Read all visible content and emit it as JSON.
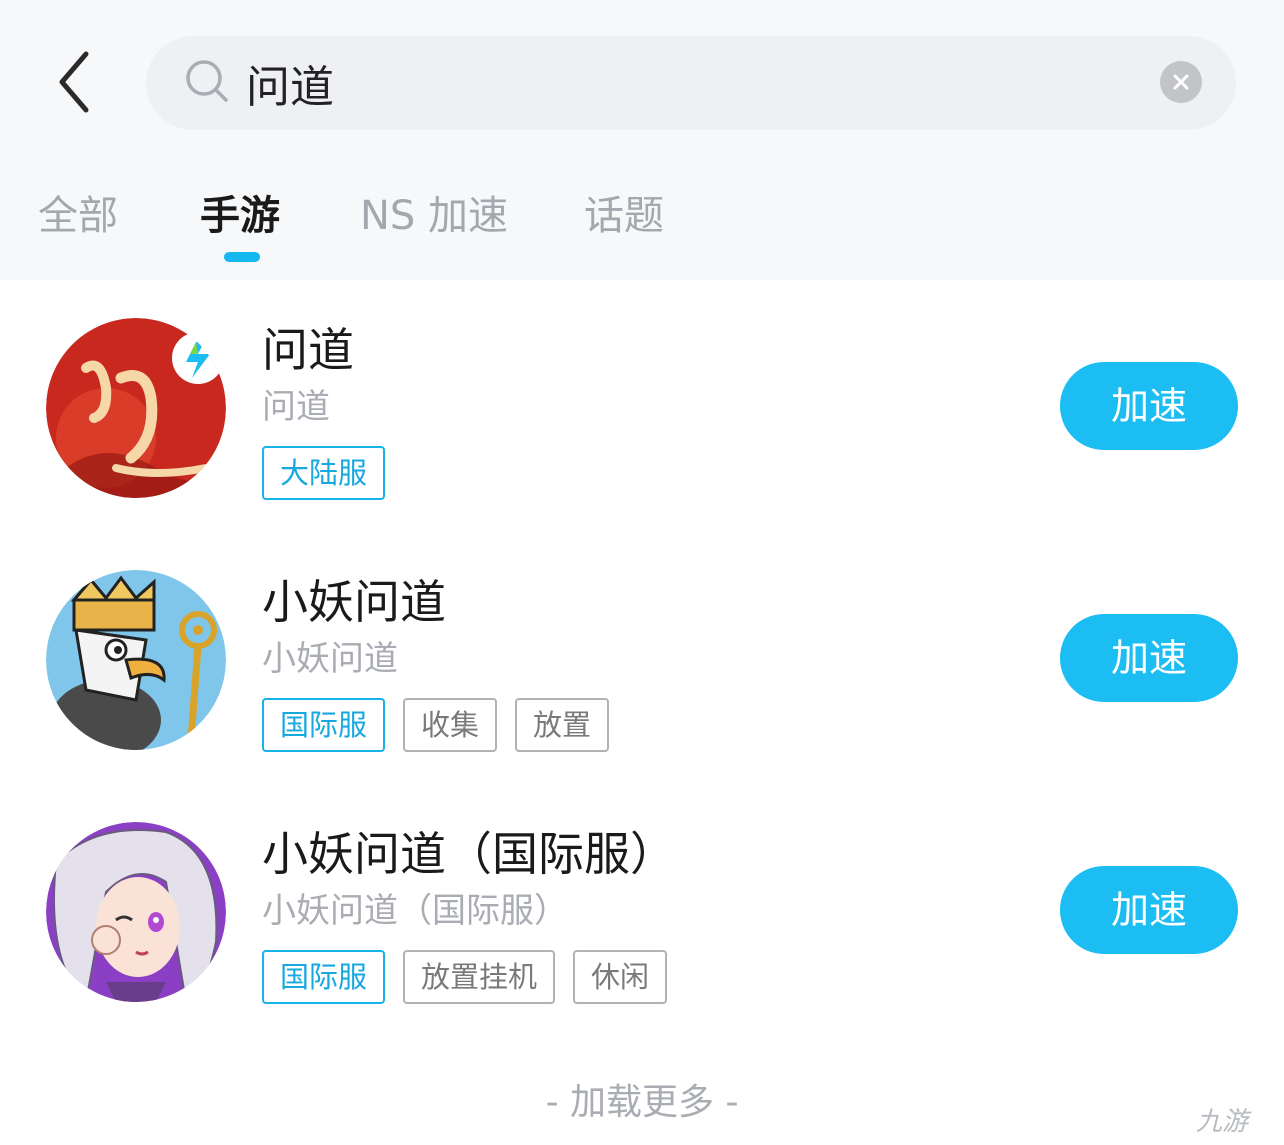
{
  "search": {
    "query": "问道"
  },
  "tabs": [
    {
      "label": "全部"
    },
    {
      "label": "手游"
    },
    {
      "label": "NS 加速"
    },
    {
      "label": "话题"
    }
  ],
  "results": [
    {
      "title": "问道",
      "subtitle": "问道",
      "tags": [
        "大陆服"
      ],
      "button": "加速"
    },
    {
      "title": "小妖问道",
      "subtitle": "小妖问道",
      "tags": [
        "国际服",
        "收集",
        "放置"
      ],
      "button": "加速"
    },
    {
      "title": "小妖问道（国际服）",
      "subtitle": "小妖问道（国际服）",
      "tags": [
        "国际服",
        "放置挂机",
        "休闲"
      ],
      "button": "加速"
    }
  ],
  "footer": {
    "load_more": "- 加载更多 -"
  },
  "watermark": "九游",
  "colors": {
    "accent": "#1cbdf2",
    "tag_primary": "#17b3ea"
  }
}
